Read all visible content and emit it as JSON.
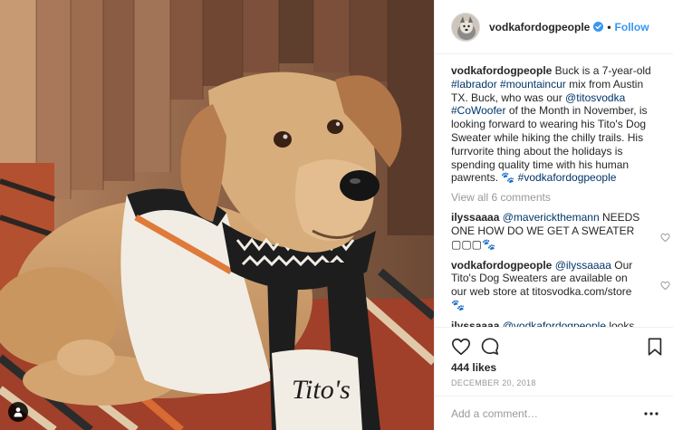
{
  "header": {
    "username": "vodkafordogpeople",
    "dot": "•",
    "follow_label": "Follow",
    "verified_icon": "verified-badge-icon",
    "accent_color": "#3897f0"
  },
  "caption": {
    "username": "vodkafordogpeople",
    "text_1": " Buck is a 7-year-old ",
    "tag_1": "#labrador",
    "text_2": " ",
    "tag_2": "#mountaincur",
    "text_3": " mix from Austin TX. Buck, who was our ",
    "tag_3": "@titosvodka",
    "text_4": " ",
    "tag_4": "#CoWoofer",
    "text_5": " of the Month in November, is looking forward to wearing his Tito's Dog Sweater while hiking the chilly trails. His furrvorite thing about the holidays is spending quality time with his human pawrents. ",
    "paws": "🐾",
    "text_6": " ",
    "tag_5": "#vodkafordogpeople"
  },
  "view_all": "View all 6 comments",
  "comments": [
    {
      "username": "ilyssaaaa",
      "mention": "@maverickthemann",
      "text": " NEEDS ONE HOW DO WE GET A SWEATER ",
      "suffix": "▢▢▢🐾"
    },
    {
      "username": "vodkafordogpeople",
      "mention": "@ilyssaaaa",
      "text": " Our Tito's Dog Sweaters are available on our web store at titosvodka.com/store ",
      "suffix": "🐾"
    },
    {
      "username": "ilyssaaaa",
      "mention": "@vodkafordogpeople",
      "text": " looks like you may be out of stock I don't see it in the dog store or the",
      "suffix": ""
    }
  ],
  "actions": {
    "like_icon": "heart-icon",
    "comment_icon": "comment-icon",
    "save_icon": "bookmark-icon"
  },
  "likes": "444 likes",
  "date": "DECEMBER 20, 2018",
  "add_comment": {
    "placeholder": "Add a comment…",
    "more_icon": "more-options-icon"
  },
  "photo": {
    "sweater_text": "Tito's",
    "user_tag_icon": "user-tag-icon"
  }
}
